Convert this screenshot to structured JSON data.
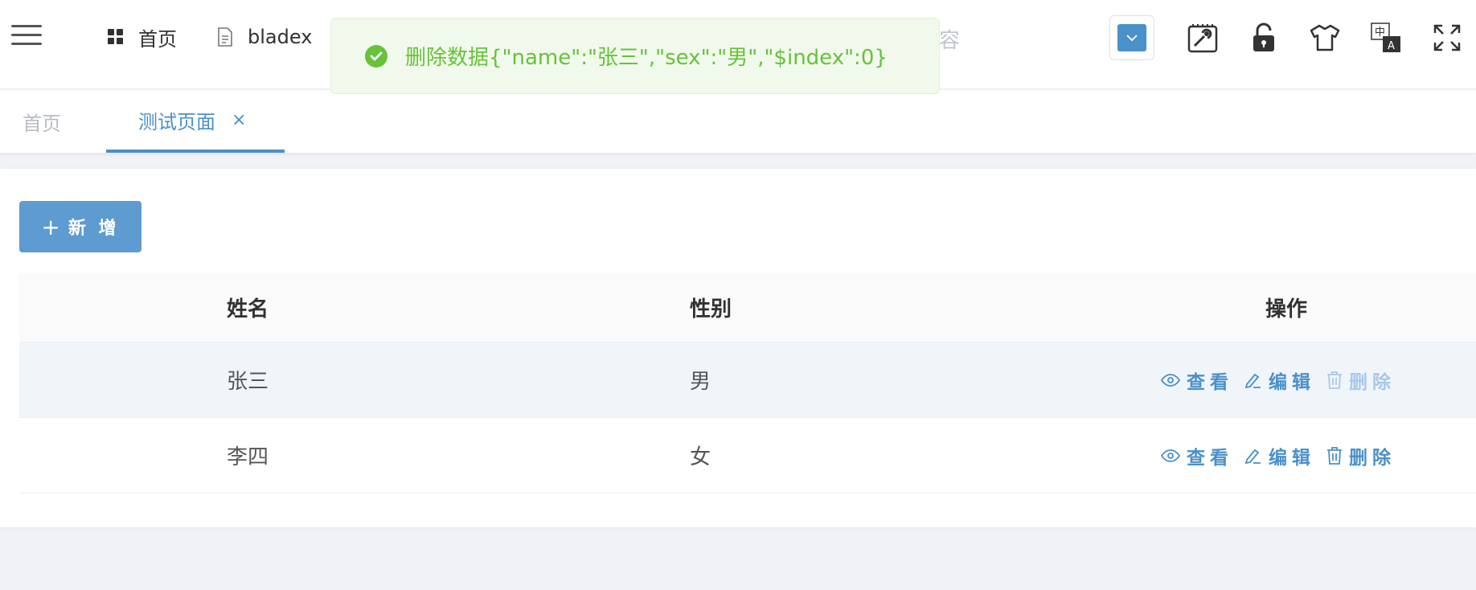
{
  "header": {
    "menu": [
      {
        "label": "首页",
        "icon": "grid-icon"
      },
      {
        "label": "bladex",
        "icon": "document-icon"
      }
    ],
    "ghost_text": "容",
    "accent_color": "#4a90c9",
    "right_icons": [
      "color-picker",
      "fullscreen-lock-screen-icon",
      "lock-icon",
      "theme-shirt-icon",
      "language-icon",
      "fullscreen-icon"
    ],
    "language_badge": {
      "top": "中",
      "bottom": "A"
    }
  },
  "toast": {
    "type": "success",
    "message": "删除数据{\"name\":\"张三\",\"sex\":\"男\",\"$index\":0}",
    "color": "#67c23a"
  },
  "tabs": [
    {
      "label": "首页",
      "active": false
    },
    {
      "label": "测试页面",
      "active": true,
      "close": "×"
    }
  ],
  "toolbar": {
    "add_label": "新 增",
    "add_icon": "+"
  },
  "table": {
    "columns": [
      "姓名",
      "性别",
      "操作"
    ],
    "rows": [
      {
        "name": "张三",
        "sex": "男"
      },
      {
        "name": "李四",
        "sex": "女"
      }
    ],
    "actions": {
      "view": "查看",
      "edit": "编辑",
      "delete": "删除"
    }
  }
}
